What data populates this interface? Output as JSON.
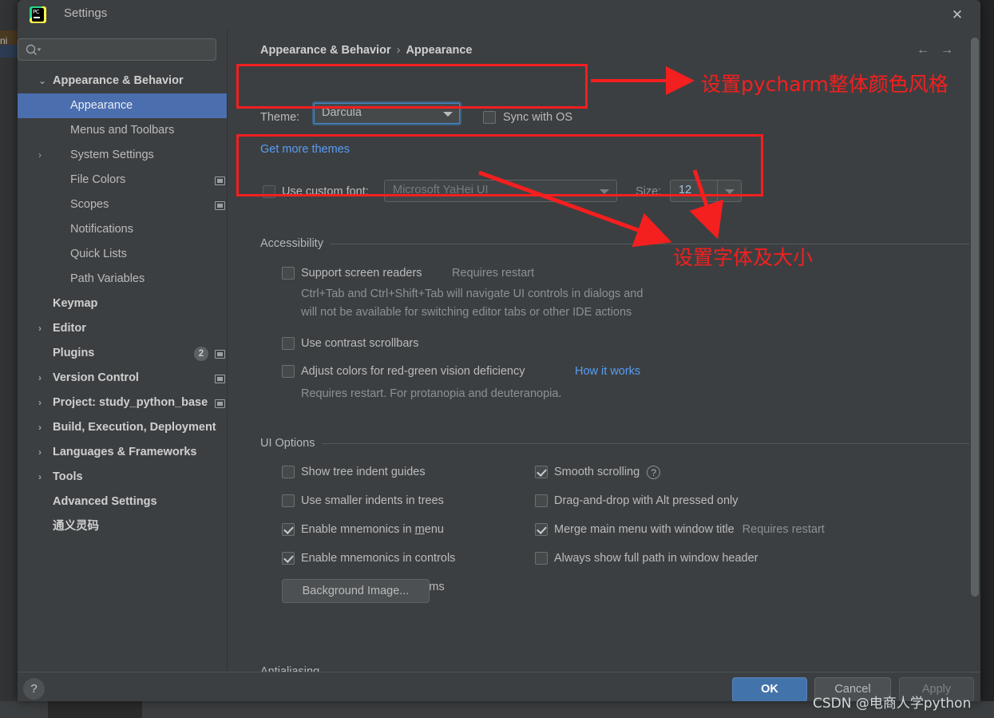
{
  "window": {
    "title": "Settings",
    "app_icon": "pycharm-icon",
    "close_icon": "close-icon"
  },
  "sidebar": {
    "search_placeholder": "",
    "search_icon": "search-icon",
    "items": [
      {
        "label": "Appearance & Behavior",
        "indent": 44,
        "arrow": "⌄",
        "bold": true,
        "selected": false
      },
      {
        "label": "Appearance",
        "indent": 66,
        "arrow": "",
        "bold": false,
        "selected": true
      },
      {
        "label": "Menus and Toolbars",
        "indent": 66,
        "arrow": "",
        "bold": false,
        "selected": false
      },
      {
        "label": "System Settings",
        "indent": 66,
        "arrow": "›",
        "bold": false,
        "selected": false
      },
      {
        "label": "File Colors",
        "indent": 66,
        "arrow": "",
        "bold": false,
        "selected": false,
        "sqicon": true
      },
      {
        "label": "Scopes",
        "indent": 66,
        "arrow": "",
        "bold": false,
        "selected": false,
        "sqicon": true
      },
      {
        "label": "Notifications",
        "indent": 66,
        "arrow": "",
        "bold": false,
        "selected": false
      },
      {
        "label": "Quick Lists",
        "indent": 66,
        "arrow": "",
        "bold": false,
        "selected": false
      },
      {
        "label": "Path Variables",
        "indent": 66,
        "arrow": "",
        "bold": false,
        "selected": false
      },
      {
        "label": "Keymap",
        "indent": 44,
        "arrow": "",
        "bold": true,
        "selected": false
      },
      {
        "label": "Editor",
        "indent": 44,
        "arrow": "›",
        "bold": true,
        "selected": false
      },
      {
        "label": "Plugins",
        "indent": 44,
        "arrow": "",
        "bold": true,
        "selected": false,
        "badge": "2",
        "sqicon": true
      },
      {
        "label": "Version Control",
        "indent": 44,
        "arrow": "›",
        "bold": true,
        "selected": false,
        "sqicon": true
      },
      {
        "label": "Project: study_python_base",
        "indent": 44,
        "arrow": "›",
        "bold": true,
        "selected": false,
        "sqicon": true
      },
      {
        "label": "Build, Execution, Deployment",
        "indent": 44,
        "arrow": "›",
        "bold": true,
        "selected": false
      },
      {
        "label": "Languages & Frameworks",
        "indent": 44,
        "arrow": "›",
        "bold": true,
        "selected": false
      },
      {
        "label": "Tools",
        "indent": 44,
        "arrow": "›",
        "bold": true,
        "selected": false
      },
      {
        "label": "Advanced Settings",
        "indent": 44,
        "arrow": "",
        "bold": true,
        "selected": false
      },
      {
        "label": "通义灵码",
        "indent": 44,
        "arrow": "",
        "bold": true,
        "selected": false
      }
    ]
  },
  "breadcrumb": {
    "parent": "Appearance & Behavior",
    "separator": "›",
    "current": "Appearance",
    "back_icon": "arrow-left-icon",
    "forward_icon": "arrow-right-icon",
    "back_glyph": "←",
    "forward_glyph": "→"
  },
  "theme": {
    "label": "Theme:",
    "value": "Darcula",
    "sync_label": "Sync with OS",
    "sync_checked": false,
    "get_more_themes": "Get more themes"
  },
  "font": {
    "use_custom_label": "Use custom font:",
    "use_custom_checked": false,
    "family_placeholder": "Microsoft YaHei UI",
    "size_label": "Size:",
    "size_value": "12"
  },
  "accessibility": {
    "title": "Accessibility",
    "screen_readers": {
      "label": "Support screen readers",
      "note": "Requires restart",
      "checked": false
    },
    "screen_readers_desc_1": "Ctrl+Tab and Ctrl+Shift+Tab will navigate UI controls in dialogs and",
    "screen_readers_desc_2": "will not be available for switching editor tabs or other IDE actions",
    "contrast_scrollbars": {
      "label": "Use contrast scrollbars",
      "checked": false
    },
    "adjust_colors": {
      "label": "Adjust colors for red-green vision deficiency",
      "checked": false
    },
    "how_it_works": "How it works",
    "adjust_colors_desc": "Requires restart. For protanopia and deuteranopia."
  },
  "ui_options": {
    "title": "UI Options",
    "left": [
      {
        "label": "Show tree indent guides",
        "checked": false
      },
      {
        "label": "Use smaller indents in trees",
        "checked": false
      },
      {
        "label": "Enable mnemonics in menu",
        "checked": true,
        "mnemonic": "m"
      },
      {
        "label": "Enable mnemonics in controls",
        "checked": true
      },
      {
        "label": "Display icons in menu items",
        "checked": true
      }
    ],
    "right": [
      {
        "label": "Smooth scrolling",
        "checked": true,
        "help_icon": "help-circle-icon"
      },
      {
        "label": "Drag-and-drop with Alt pressed only",
        "checked": false
      },
      {
        "label": "Merge main menu with window title",
        "checked": true,
        "note": "Requires restart"
      },
      {
        "label": "Always show full path in window header",
        "checked": false
      }
    ],
    "background_image_button": "Background Image..."
  },
  "antialiasing": {
    "title": "Antialiasing"
  },
  "footer": {
    "help_glyph": "?",
    "ok": "OK",
    "cancel": "Cancel",
    "apply": "Apply"
  },
  "annotations": {
    "theme_note": "设置pycharm整体颜色风格",
    "font_note": "设置字体及大小",
    "color": "#f41f1f"
  },
  "watermark": {
    "text": "CSDN @电商人学python"
  },
  "background": {
    "edge_text": "ni"
  }
}
